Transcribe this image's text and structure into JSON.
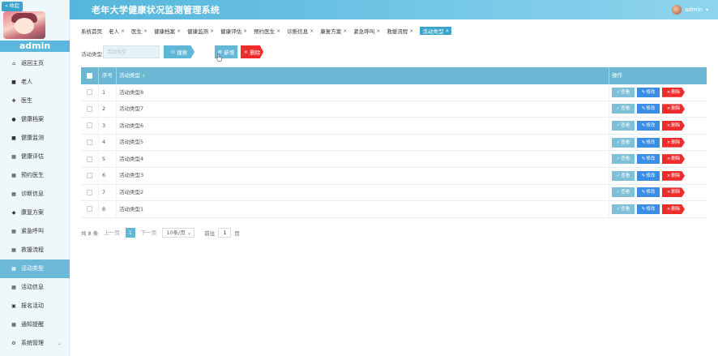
{
  "header": {
    "title": "老年大学健康状况监测管理系统",
    "user": "admin"
  },
  "sidebar": {
    "collapse_label": "« 收起",
    "admin_name": "admin",
    "items": [
      {
        "label": "返回主页",
        "icon": "home-icon",
        "glyph": "⌂"
      },
      {
        "label": "老人",
        "icon": "list-icon",
        "glyph": "■"
      },
      {
        "label": "医生",
        "icon": "doctor-icon",
        "glyph": "✚"
      },
      {
        "label": "健康档案",
        "icon": "person-icon",
        "glyph": "●"
      },
      {
        "label": "健康监测",
        "icon": "monitor-icon",
        "glyph": "■"
      },
      {
        "label": "健康评估",
        "icon": "grid-icon",
        "glyph": "▦"
      },
      {
        "label": "预约医生",
        "icon": "grid-icon",
        "glyph": "▦"
      },
      {
        "label": "诊断信息",
        "icon": "grid-icon",
        "glyph": "▦"
      },
      {
        "label": "康复方案",
        "icon": "pin-icon",
        "glyph": "◆"
      },
      {
        "label": "紧急呼叫",
        "icon": "grid-icon",
        "glyph": "▦"
      },
      {
        "label": "救援流程",
        "icon": "grid-icon",
        "glyph": "▦"
      },
      {
        "label": "活动类型",
        "icon": "grid-icon",
        "glyph": "▦",
        "active": true
      },
      {
        "label": "活动信息",
        "icon": "grid-icon",
        "glyph": "▦"
      },
      {
        "label": "报名活动",
        "icon": "db-icon",
        "glyph": "▣"
      },
      {
        "label": "通知提醒",
        "icon": "grid-icon",
        "glyph": "▦"
      },
      {
        "label": "系统管理",
        "icon": "settings-icon",
        "glyph": "⚙",
        "arrow": "⌄"
      }
    ]
  },
  "tabs": [
    {
      "label": "系统首页",
      "closable": false
    },
    {
      "label": "老人",
      "closable": true
    },
    {
      "label": "医生",
      "closable": true
    },
    {
      "label": "健康档案",
      "closable": true
    },
    {
      "label": "健康监测",
      "closable": true
    },
    {
      "label": "健康评估",
      "closable": true
    },
    {
      "label": "预约医生",
      "closable": true
    },
    {
      "label": "诊断信息",
      "closable": true
    },
    {
      "label": "康复方案",
      "closable": true
    },
    {
      "label": "紧急呼叫",
      "closable": true
    },
    {
      "label": "救援流程",
      "closable": true
    },
    {
      "label": "活动类型",
      "closable": true,
      "active": true
    }
  ],
  "search": {
    "label": "活动类型",
    "placeholder": "活动类型",
    "button": "搜索",
    "add": "新增",
    "delete": "删除"
  },
  "table": {
    "headers": {
      "index": "序号",
      "name": "活动类型",
      "ops": "操作"
    },
    "rows": [
      {
        "index": "1",
        "name": "活动类型8"
      },
      {
        "index": "2",
        "name": "活动类型7"
      },
      {
        "index": "3",
        "name": "活动类型6"
      },
      {
        "index": "4",
        "name": "活动类型5"
      },
      {
        "index": "5",
        "name": "活动类型4"
      },
      {
        "index": "6",
        "name": "活动类型3"
      },
      {
        "index": "7",
        "name": "活动类型2"
      },
      {
        "index": "8",
        "name": "活动类型1"
      }
    ],
    "ops": {
      "view": "查看",
      "edit": "修改",
      "delete": "删除"
    }
  },
  "pager": {
    "total": "共 8 条",
    "prev": "上一页",
    "page": "1",
    "next": "下一页",
    "size": "10条/页",
    "goto": "前往",
    "goto_value": "1",
    "unit": "页"
  },
  "colors": {
    "accent": "#5fb6d6",
    "danger": "#ee2c2c",
    "edit": "#3a8ee6"
  }
}
